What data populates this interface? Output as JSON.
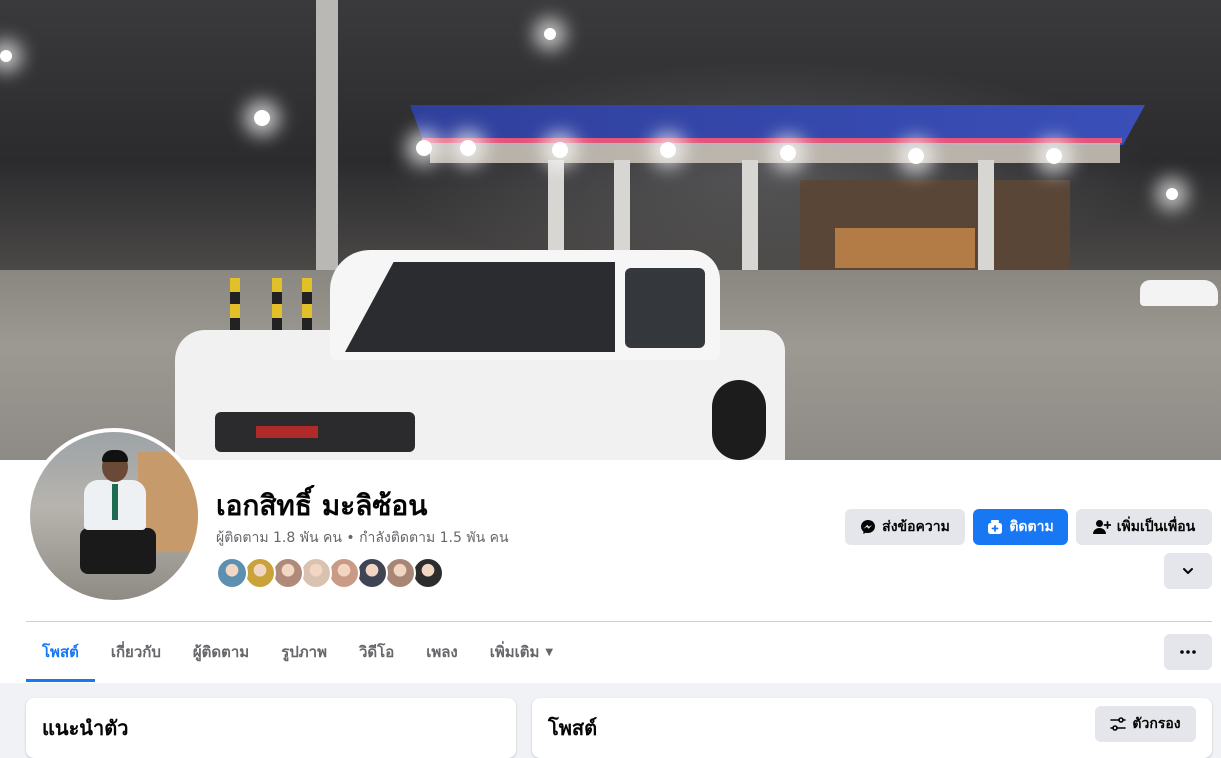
{
  "profile": {
    "name": "เอกสิทธิ์ มะลิซ้อน",
    "stats": "ผู้ติดตาม 1.8 พัน คน • กำลังติดตาม 1.5 พัน คน"
  },
  "friends_preview": {
    "colors": [
      "#5d8fb0",
      "#c9a33a",
      "#b08a78",
      "#d9c3b0",
      "#c99a86",
      "#3f4454",
      "#a88676",
      "#2d2d2d"
    ]
  },
  "actions": {
    "message_label": "ส่งข้อความ",
    "follow_label": "ติดตาม",
    "add_friend_label": "เพิ่มเป็นเพื่อน",
    "more_icon": "chevron-down-icon"
  },
  "tabs": [
    {
      "label": "โพสต์",
      "active": true
    },
    {
      "label": "เกี่ยวกับ",
      "active": false
    },
    {
      "label": "ผู้ติดตาม",
      "active": false
    },
    {
      "label": "รูปภาพ",
      "active": false
    },
    {
      "label": "วิดีโอ",
      "active": false
    },
    {
      "label": "เพลง",
      "active": false
    },
    {
      "label": "เพิ่มเติม",
      "active": false
    }
  ],
  "intro": {
    "title": "แนะนำตัว"
  },
  "posts": {
    "title": "โพสต์",
    "filter_label": "ตัวกรอง"
  },
  "colors": {
    "accent": "#1877f2",
    "button_gray": "#e4e6eb",
    "page_bg": "#f0f2f5",
    "text_secondary": "#65676b"
  }
}
